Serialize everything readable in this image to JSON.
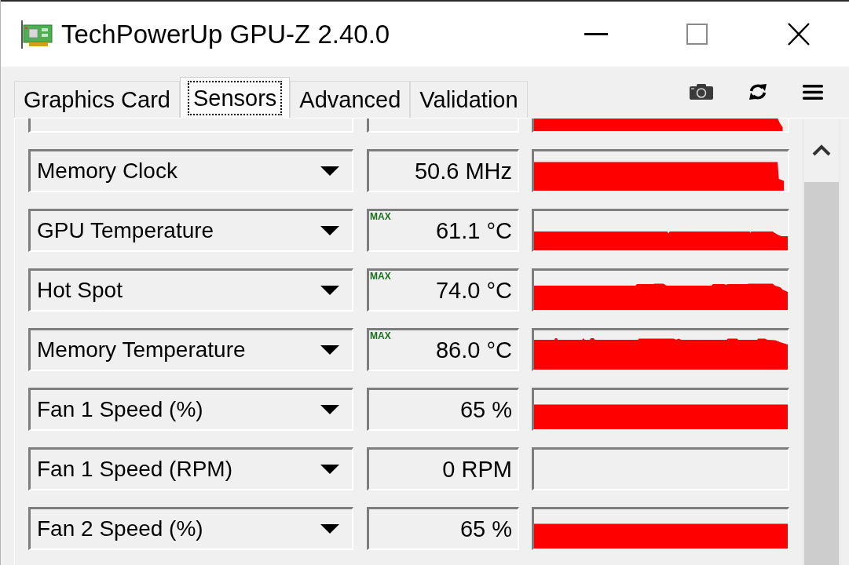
{
  "window": {
    "title": "TechPowerUp GPU-Z 2.40.0"
  },
  "tabs": [
    {
      "label": "Graphics Card",
      "selected": false
    },
    {
      "label": "Sensors",
      "selected": true
    },
    {
      "label": "Advanced",
      "selected": false
    },
    {
      "label": "Validation",
      "selected": false
    }
  ],
  "sensors": [
    {
      "kind": "partial"
    },
    {
      "kind": "sensor",
      "name": "Memory Clock",
      "value": "50.6 MHz"
    },
    {
      "kind": "sensor",
      "name": "GPU Temperature",
      "value": "61.1 °C",
      "badge": "MAX"
    },
    {
      "kind": "sensor",
      "name": "Hot Spot",
      "value": "74.0 °C",
      "badge": "MAX"
    },
    {
      "kind": "sensor",
      "name": "Memory Temperature",
      "value": "86.0 °C",
      "badge": "MAX"
    },
    {
      "kind": "sensor",
      "name": "Fan 1 Speed (%)",
      "value": "65 %"
    },
    {
      "kind": "sensor",
      "name": "Fan 1 Speed (RPM)",
      "value": "0 RPM"
    },
    {
      "kind": "sensor",
      "name": "Fan 2 Speed (%)",
      "value": "65 %"
    }
  ]
}
